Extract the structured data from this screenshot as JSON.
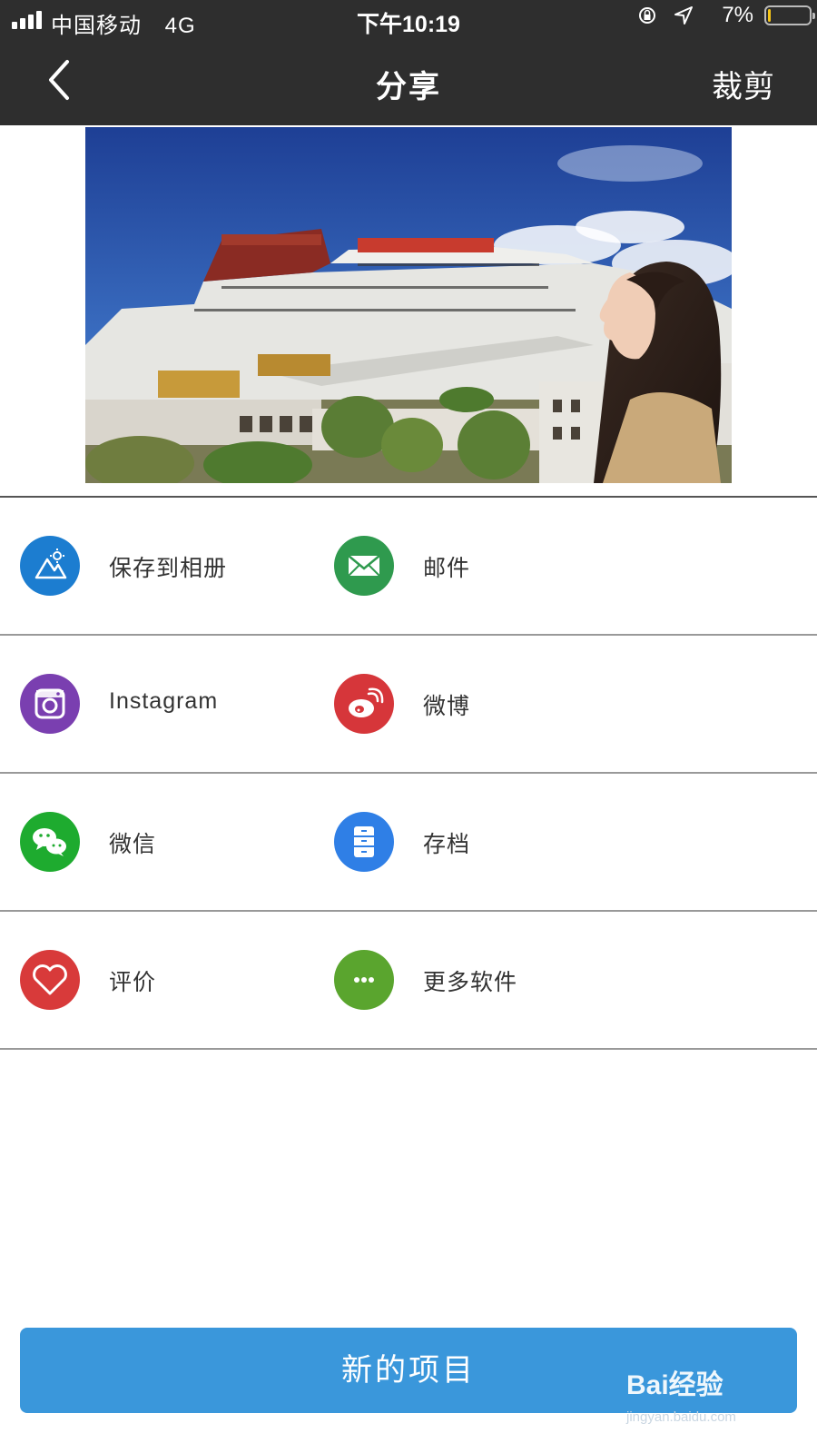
{
  "status_bar": {
    "carrier": "中国移动",
    "network": "4G",
    "time": "下午10:19",
    "battery_percent": "7%",
    "battery_level": 0.07
  },
  "nav": {
    "title": "分享",
    "crop_label": "裁剪"
  },
  "share_options": {
    "save_album": "保存到相册",
    "mail": "邮件",
    "instagram": "Instagram",
    "weibo": "微博",
    "wechat": "微信",
    "archive": "存档",
    "rate": "评价",
    "more_apps": "更多软件"
  },
  "icons": {
    "save_album": {
      "name": "album-icon",
      "color": "#1c7dd0"
    },
    "mail": {
      "name": "mail-icon",
      "color": "#2f9a4e"
    },
    "instagram": {
      "name": "instagram-icon",
      "color": "#7a3fb0"
    },
    "weibo": {
      "name": "weibo-icon",
      "color": "#d6363a"
    },
    "wechat": {
      "name": "wechat-icon",
      "color": "#1eab2f"
    },
    "archive": {
      "name": "archive-icon",
      "color": "#2f7fe6"
    },
    "rate": {
      "name": "heart-icon",
      "color": "#d83a3a"
    },
    "more_apps": {
      "name": "more-icon",
      "color": "#5aa52e"
    }
  },
  "footer": {
    "new_project_label": "新的项目"
  },
  "watermark": {
    "brand": "Bai经验",
    "url": "jingyan.baidu.com"
  },
  "colors": {
    "header_bg": "#2e2e2e",
    "button_bg": "#3a97db"
  }
}
